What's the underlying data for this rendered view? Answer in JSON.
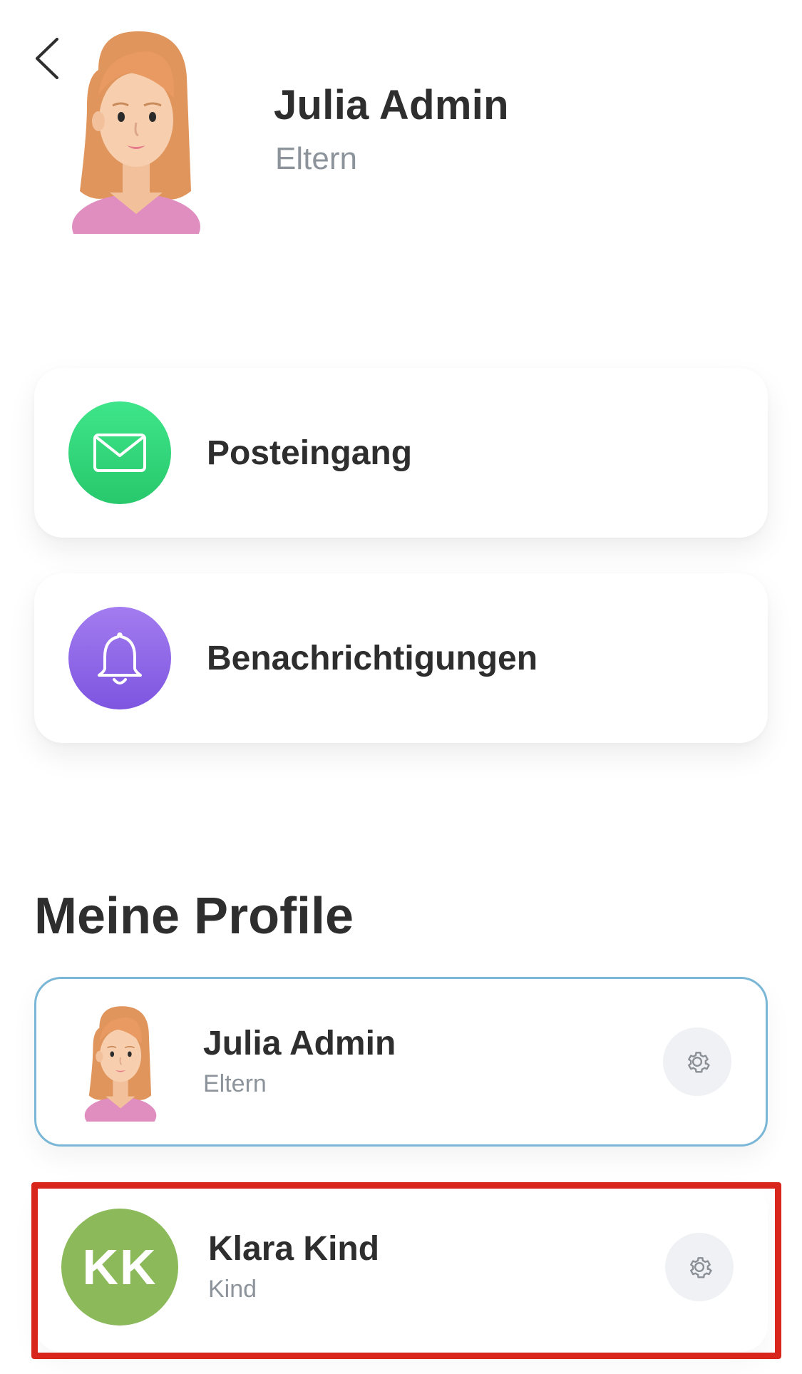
{
  "header": {
    "back_icon": "chevron-left-icon",
    "name": "Julia Admin",
    "role": "Eltern"
  },
  "menu": [
    {
      "label": "Posteingang",
      "icon": "mail-icon",
      "color": "#2ed47a"
    },
    {
      "label": "Benachrichtigungen",
      "icon": "bell-icon",
      "color": "#8e66e8"
    }
  ],
  "profiles_section": {
    "title": "Meine Profile",
    "profiles": [
      {
        "name": "Julia Admin",
        "role": "Eltern",
        "avatar": "female-avatar",
        "settings_icon": "gear-icon",
        "selected": true
      },
      {
        "name": "Klara Kind",
        "role": "Kind",
        "initials": "KK",
        "avatar_color": "#8cb95a",
        "settings_icon": "gear-icon",
        "highlighted": true
      }
    ]
  },
  "colors": {
    "accent_border": "#7ab6d6",
    "highlight": "#d9261c"
  }
}
